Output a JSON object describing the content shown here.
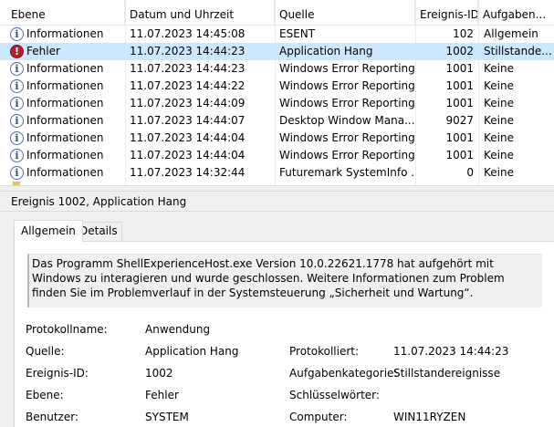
{
  "columns": {
    "level": "Ebene",
    "datetime": "Datum und Uhrzeit",
    "source": "Quelle",
    "event_id": "Ereignis-ID",
    "task": "Aufgaben..."
  },
  "events": [
    {
      "level": "Informationen",
      "type": "info",
      "datetime": "11.07.2023 14:45:08",
      "source": "ESENT",
      "event_id": "102",
      "task": "Allgemein"
    },
    {
      "level": "Fehler",
      "type": "error",
      "datetime": "11.07.2023 14:44:23",
      "source": "Application Hang",
      "event_id": "1002",
      "task": "Stillstande...",
      "selected": true
    },
    {
      "level": "Informationen",
      "type": "info",
      "datetime": "11.07.2023 14:44:23",
      "source": "Windows Error Reporting",
      "event_id": "1001",
      "task": "Keine"
    },
    {
      "level": "Informationen",
      "type": "info",
      "datetime": "11.07.2023 14:44:22",
      "source": "Windows Error Reporting",
      "event_id": "1001",
      "task": "Keine"
    },
    {
      "level": "Informationen",
      "type": "info",
      "datetime": "11.07.2023 14:44:09",
      "source": "Windows Error Reporting",
      "event_id": "1001",
      "task": "Keine"
    },
    {
      "level": "Informationen",
      "type": "info",
      "datetime": "11.07.2023 14:44:07",
      "source": "Desktop Window Mana...",
      "event_id": "9027",
      "task": "Keine"
    },
    {
      "level": "Informationen",
      "type": "info",
      "datetime": "11.07.2023 14:44:04",
      "source": "Windows Error Reporting",
      "event_id": "1001",
      "task": "Keine"
    },
    {
      "level": "Informationen",
      "type": "info",
      "datetime": "11.07.2023 14:44:04",
      "source": "Windows Error Reporting",
      "event_id": "1001",
      "task": "Keine"
    },
    {
      "level": "Informationen",
      "type": "info",
      "datetime": "11.07.2023 14:32:44",
      "source": "Futuremark SystemInfo ...",
      "event_id": "0",
      "task": "Keine"
    }
  ],
  "detail": {
    "title": "Ereignis 1002, Application Hang",
    "tabs": {
      "general": "Allgemein",
      "details": "Details"
    },
    "description": "Das Programm ShellExperienceHost.exe Version 10.0.22621.1778 hat aufgehört mit Windows zu interagieren und wurde geschlossen. Weitere Informationen zum Problem finden Sie im Problemverlauf in der Systemsteuerung „Sicherheit und Wartung“.",
    "fields": {
      "log_name_label": "Protokollname:",
      "log_name": "Anwendung",
      "source_label": "Quelle:",
      "source": "Application Hang",
      "logged_label": "Protokolliert:",
      "logged": "11.07.2023 14:44:23",
      "event_id_label": "Ereignis-ID:",
      "event_id": "1002",
      "task_category_label": "Aufgabenkategorie:",
      "task_category": "Stillstandereignisse",
      "level_label": "Ebene:",
      "level": "Fehler",
      "keywords_label": "Schlüsselwörter:",
      "keywords": "",
      "user_label": "Benutzer:",
      "user": "SYSTEM",
      "computer_label": "Computer:",
      "computer": "WIN11RYZEN"
    }
  },
  "colors": {
    "selection": "#cce8ff",
    "pane_background": "#f0f0f0",
    "error_icon": "#b51f2b",
    "info_icon": "#4a6ea8"
  }
}
